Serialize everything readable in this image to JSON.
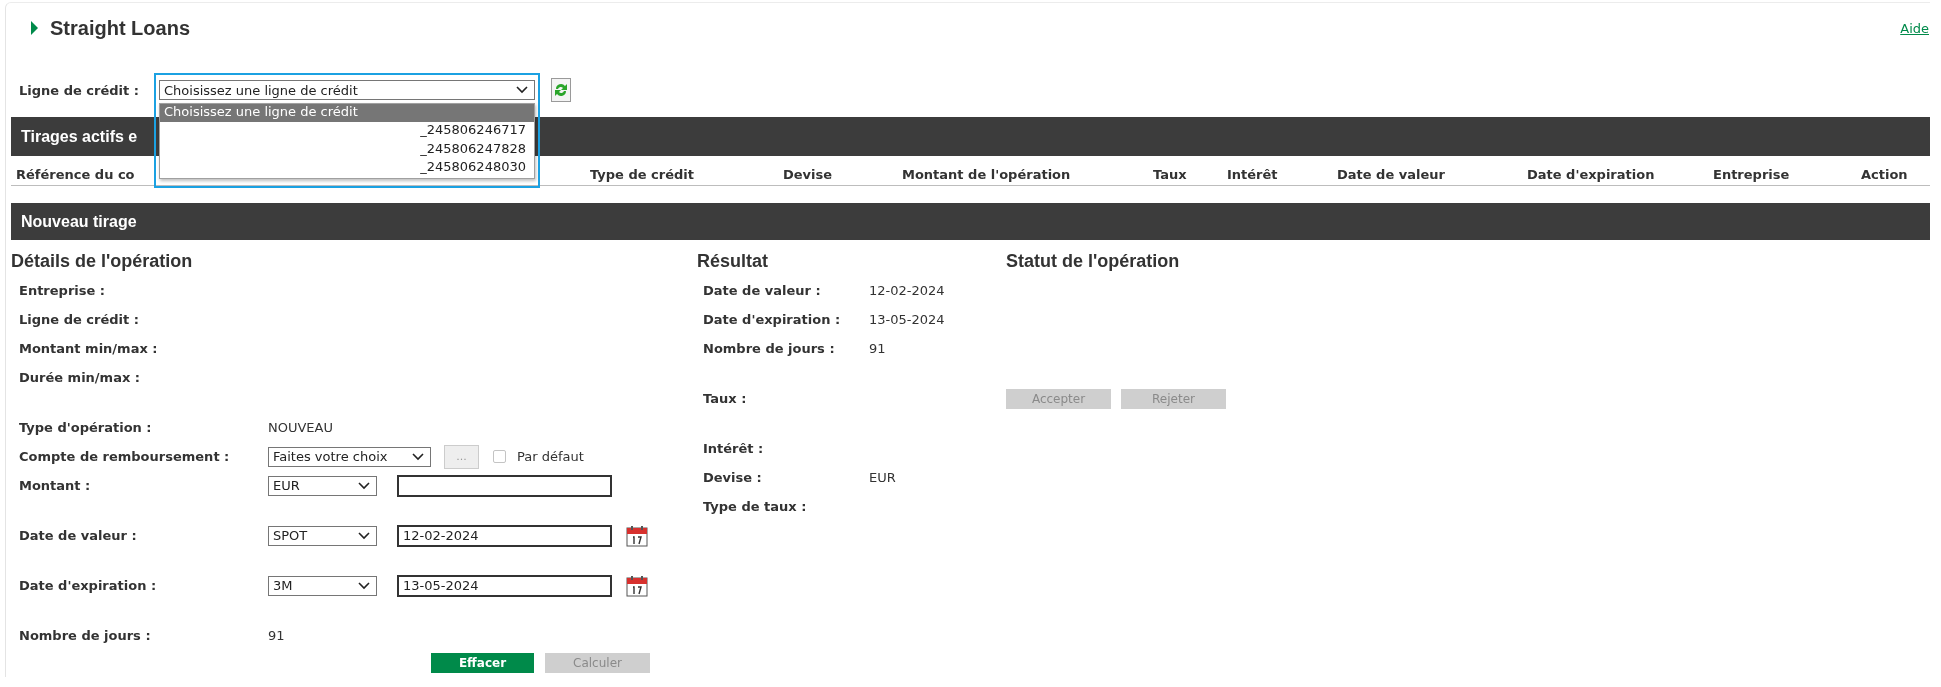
{
  "page": {
    "title": "Straight Loans",
    "help_link": "Aide"
  },
  "credit_line": {
    "label": "Ligne de crédit :",
    "value": "Choisissez une ligne de crédit",
    "expanded": true,
    "options": [
      {
        "label": "Choisissez une ligne de crédit",
        "selected": true
      },
      {
        "label": "_245806246717",
        "selected": false
      },
      {
        "label": "_245806247828",
        "selected": false
      },
      {
        "label": "_245806248030",
        "selected": false
      }
    ]
  },
  "active_drawings": {
    "title": "Tirages actifs e",
    "columns": [
      "Référence du co",
      "Type de crédit",
      "Devise",
      "Montant de l'opération",
      "Taux",
      "Intérêt",
      "Date de valeur",
      "Date d'expiration",
      "Entreprise",
      "Action"
    ]
  },
  "new_drawing": {
    "title": "Nouveau tirage",
    "details": {
      "heading": "Détails de l'opération",
      "groups": [
        [
          {
            "kind": "label",
            "label": "Entreprise :"
          },
          {
            "kind": "label",
            "label": "Ligne de crédit :"
          },
          {
            "kind": "label",
            "label": "Montant min/max :"
          },
          {
            "kind": "label",
            "label": "Durée min/max :"
          }
        ],
        [
          {
            "kind": "text",
            "label": "Type d'opération :",
            "value": "NOUVEAU"
          },
          {
            "kind": "account",
            "label": "Compte de remboursement :",
            "select": "Faites votre choix",
            "more_button": "...",
            "default_label": "Par défaut",
            "default_checked": false
          },
          {
            "kind": "amount",
            "label": "Montant :",
            "currency": "EUR"
          }
        ],
        [
          {
            "kind": "date",
            "label": "Date de valeur :",
            "tenor": "SPOT",
            "date": "12-02-2024"
          }
        ],
        [
          {
            "kind": "date",
            "label": "Date d'expiration :",
            "tenor": "3M",
            "date": "13-05-2024"
          }
        ],
        [
          {
            "kind": "text",
            "label": "Nombre de jours :",
            "value": "91"
          }
        ]
      ],
      "buttons": [
        {
          "label": "Effacer",
          "disabled": false
        },
        {
          "label": "Calculer",
          "disabled": true
        }
      ]
    },
    "result": {
      "heading": "Résultat",
      "status_heading": "Statut de l'opération",
      "groups": [
        {
          "kind": "dates",
          "rows": [
            {
              "label": "Date de valeur :",
              "value": "12-02-2024"
            },
            {
              "label": "Date d'expiration :",
              "value": "13-05-2024"
            },
            {
              "label": "Nombre de jours :",
              "value": "91"
            }
          ]
        },
        {
          "kind": "rate",
          "rows": [
            {
              "label": "Taux :"
            }
          ]
        },
        {
          "kind": "amounts",
          "rows": [
            {
              "label": "Intérêt :"
            },
            {
              "label": "Devise :",
              "value": "EUR"
            },
            {
              "label": "Type de taux :"
            }
          ]
        }
      ],
      "status_buttons": [
        {
          "label": "Accepter",
          "disabled": true
        },
        {
          "label": "Rejeter",
          "disabled": true
        }
      ]
    }
  }
}
